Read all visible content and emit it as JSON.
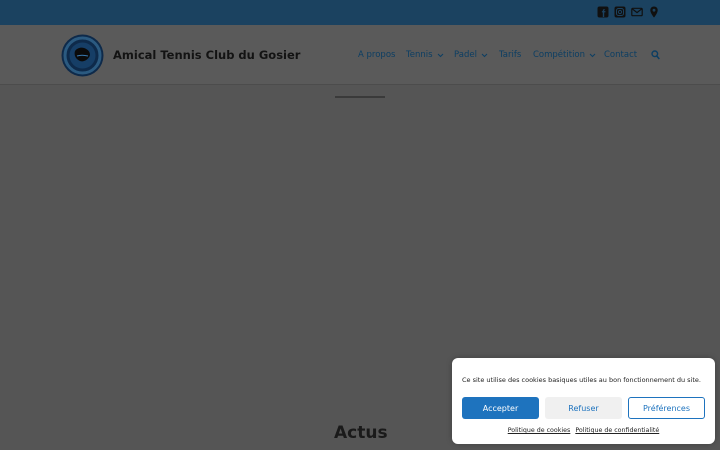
{
  "topbar": {
    "social_icons": [
      "facebook-icon",
      "instagram-icon",
      "mail-icon",
      "map-pin-icon"
    ]
  },
  "header": {
    "site_title": "Amical Tennis Club du Gosier",
    "logo_icon": "club-logo-icon"
  },
  "nav": {
    "items": [
      {
        "label": "A propos",
        "has_dropdown": false
      },
      {
        "label": "Tennis",
        "has_dropdown": true
      },
      {
        "label": "Padel",
        "has_dropdown": true
      },
      {
        "label": "Tarifs",
        "has_dropdown": false
      },
      {
        "label": "Compétition",
        "has_dropdown": true
      },
      {
        "label": "Contact",
        "has_dropdown": false
      }
    ],
    "search_icon": "search-icon"
  },
  "main": {
    "section_title": "Actus"
  },
  "cookie_banner": {
    "message": "Ce site utilise des cookies basiques utiles au bon fonctionnement du site.",
    "accept_label": "Accepter",
    "refuse_label": "Refuser",
    "preferences_label": "Préférences",
    "cookie_policy_link": "Politique de cookies",
    "privacy_policy_link": "Politique de confidentialité"
  },
  "colors": {
    "topbar_bg": "#1b4260",
    "overlay_bg": "#555555",
    "nav_link": "#0c3e63",
    "accent": "#1e73be"
  }
}
